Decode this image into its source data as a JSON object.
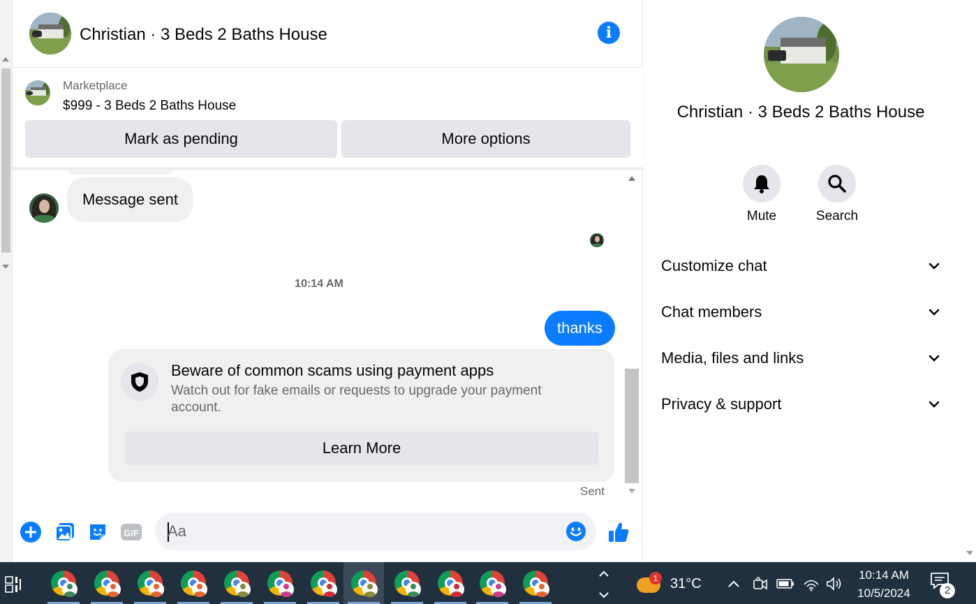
{
  "header": {
    "title": "Christian · 3 Beds 2 Baths House"
  },
  "listing": {
    "category": "Marketplace",
    "title": "$999 - 3 Beds 2 Baths House",
    "mark_pending_label": "Mark as pending",
    "more_options_label": "More options"
  },
  "messages": {
    "incoming_text": "Message sent",
    "time_separator": "10:14 AM",
    "outgoing_text": "thanks",
    "scam_card": {
      "title": "Beware of common scams using payment apps",
      "body": "Watch out for fake emails or requests to upgrade your payment account.",
      "button_label": "Learn More"
    },
    "status": "Sent"
  },
  "composer": {
    "placeholder": "Aa",
    "icons": [
      "plus-icon",
      "photo-icon",
      "sticker-icon",
      "gif-icon",
      "emoji-icon",
      "thumbs-up-icon"
    ],
    "gif_label": "GIF"
  },
  "info_panel": {
    "name": "Christian · 3 Beds 2 Baths House",
    "mute_label": "Mute",
    "search_label": "Search",
    "sections": [
      "Customize chat",
      "Chat members",
      "Media, files and links",
      "Privacy & support"
    ]
  },
  "taskbar": {
    "weather_alert_count": "1",
    "temperature": "31°C",
    "time": "10:14 AM",
    "date": "10/5/2024",
    "notification_count": "2"
  },
  "colors": {
    "accent": "#0a7cff",
    "bubble_gray": "#f0f0f0",
    "button_gray": "#e4e6eb",
    "taskbar": "#20303f"
  }
}
